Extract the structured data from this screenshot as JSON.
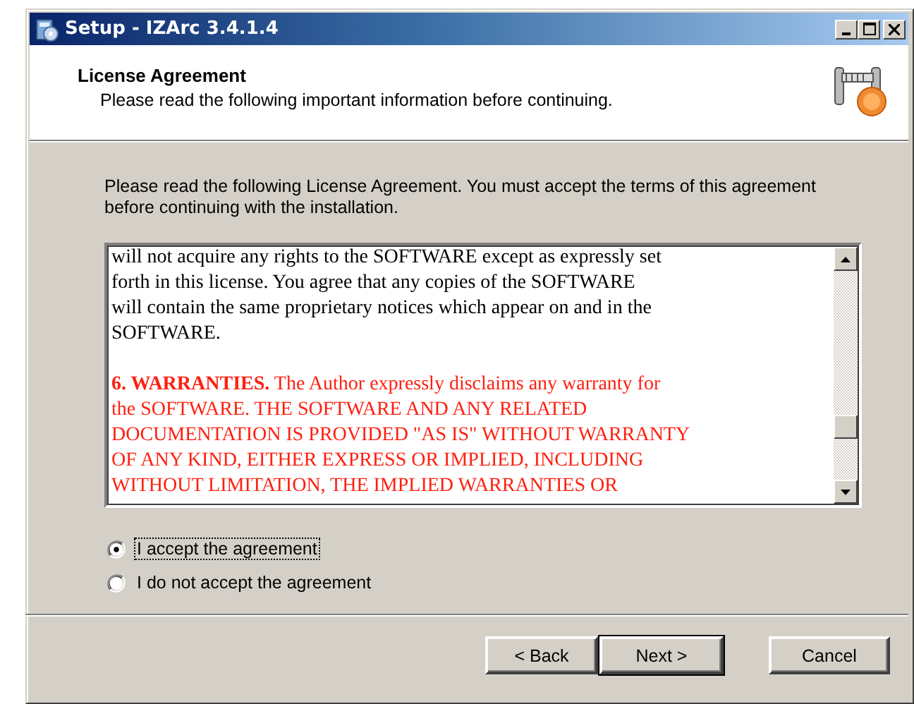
{
  "window": {
    "title": "Setup - IZArc 3.4.1.4"
  },
  "header": {
    "title": "License Agreement",
    "subtitle": "Please read the following important information before continuing."
  },
  "intro": "Please read the following License Agreement. You must accept the terms of this agreement before continuing with the installation.",
  "license": [
    {
      "kind": "normal",
      "lines": [
        "will not acquire any rights to the SOFTWARE except as expressly set",
        "forth in this license. You agree that any copies of the SOFTWARE",
        "will contain the same proprietary notices which appear on and in the",
        "SOFTWARE."
      ]
    },
    {
      "kind": "warning",
      "lines": [
        "**6. WARRANTIES.** The Author expressly disclaims any warranty for",
        "the SOFTWARE. THE SOFTWARE AND ANY RELATED",
        "DOCUMENTATION IS PROVIDED \"AS IS\" WITHOUT WARRANTY",
        "OF ANY KIND, EITHER EXPRESS OR IMPLIED, INCLUDING",
        "WITHOUT LIMITATION, THE IMPLIED WARRANTIES OR"
      ]
    }
  ],
  "options": [
    {
      "label": "I accept the agreement",
      "selected": true
    },
    {
      "label": "I do not accept the agreement",
      "selected": false
    }
  ],
  "buttons": [
    {
      "label": "< Back",
      "default": false
    },
    {
      "label": "Next >",
      "default": true
    },
    {
      "label": "Cancel",
      "default": false
    }
  ]
}
